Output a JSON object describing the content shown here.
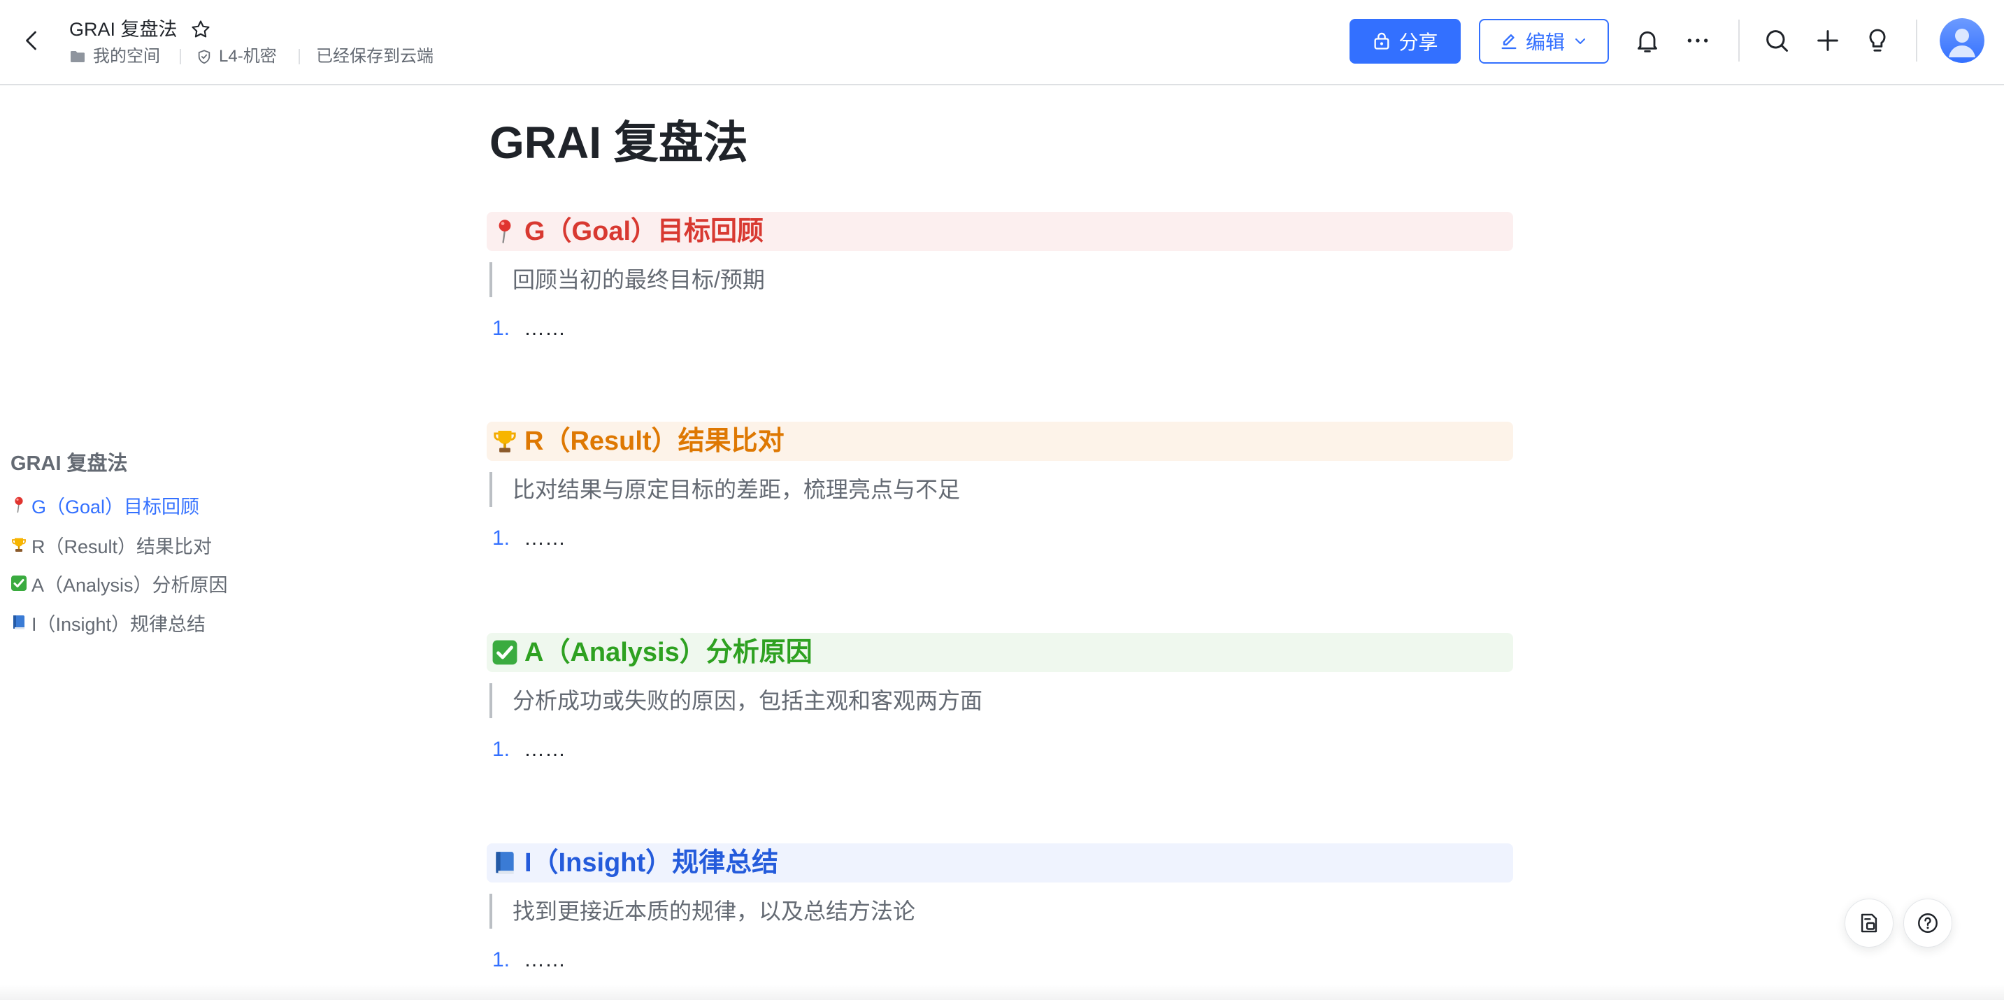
{
  "header": {
    "back_icon": "chevron-left-icon",
    "doc_title": "GRAI 复盘法",
    "star_icon": "star-icon",
    "breadcrumb": {
      "folder_icon": "folder-icon",
      "location": "我的空间",
      "security_icon": "shield-check-icon",
      "security_level": "L4-机密",
      "save_status": "已经保存到云端"
    },
    "share": {
      "icon": "lock-share-icon",
      "label": "分享"
    },
    "edit": {
      "icon": "pencil-icon",
      "label": "编辑",
      "dropdown_icon": "chevron-down-icon"
    },
    "toolbar_icons": [
      "bell-icon",
      "more-icon",
      "search-icon",
      "plus-icon",
      "lightbulb-icon"
    ],
    "avatar_icon": "user-avatar-icon",
    "accent_color": "#3370ff"
  },
  "toc": {
    "title": "GRAI 复盘法",
    "items": [
      {
        "icon": "round-pushpin-icon",
        "label": "G（Goal）目标回顾",
        "active": true
      },
      {
        "icon": "trophy-icon",
        "label": "R（Result）结果比对",
        "active": false
      },
      {
        "icon": "check-mark-button-icon",
        "label": "A（Analysis）分析原因",
        "active": false
      },
      {
        "icon": "blue-book-icon",
        "label": "I（Insight）规律总结",
        "active": false
      }
    ]
  },
  "document": {
    "title": "GRAI 复盘法",
    "sections": [
      {
        "icon": "round-pushpin-icon",
        "heading": "G（Goal）目标回顾",
        "text_color": "#d83931",
        "background": "#fcefef",
        "quote": "回顾当初的最终目标/预期",
        "list": [
          {
            "number": "1.",
            "text": "……"
          }
        ]
      },
      {
        "icon": "trophy-icon",
        "heading": "R（Result）结果比对",
        "text_color": "#de7802",
        "background": "#fdf3e9",
        "quote": "比对结果与原定目标的差距，梳理亮点与不足",
        "list": [
          {
            "number": "1.",
            "text": "……"
          }
        ]
      },
      {
        "icon": "check-mark-button-icon",
        "heading": "A（Analysis）分析原因",
        "text_color": "#2ea121",
        "background": "#eff8ee",
        "quote": "分析成功或失败的原因，包括主观和客观两方面",
        "list": [
          {
            "number": "1.",
            "text": "……"
          }
        ]
      },
      {
        "icon": "blue-book-icon",
        "heading": "I（Insight）规律总结",
        "text_color": "#245bdb",
        "background": "#eff3fe",
        "quote": "找到更接近本质的规律，以及总结方法论",
        "list": [
          {
            "number": "1.",
            "text": "……"
          }
        ]
      }
    ]
  },
  "floating_buttons": [
    {
      "icon": "outline-doc-icon"
    },
    {
      "icon": "help-icon"
    }
  ]
}
